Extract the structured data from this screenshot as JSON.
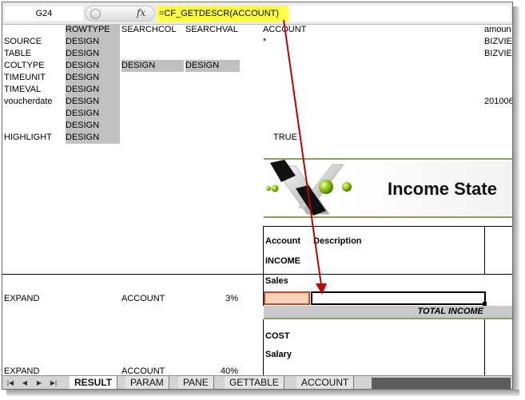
{
  "formula_bar": {
    "name_box": "G24",
    "fx_label": "fx",
    "formula": "=CF_GETDESCR(ACCOUNT)"
  },
  "grid": {
    "col_headers": {
      "rowtype": "ROWTYPE",
      "searchcol": "SEARCHCOL",
      "searchval": "SEARCHVAL",
      "account": "ACCOUNT",
      "amount": "amoun"
    },
    "rows": [
      {
        "label": "SOURCE",
        "rowtype": "DESIGN",
        "account": "*",
        "amount": "BIZVIE"
      },
      {
        "label": "TABLE",
        "rowtype": "DESIGN",
        "amount": "BIZVIE"
      },
      {
        "label": "COLTYPE",
        "rowtype": "DESIGN",
        "searchcol": "DESIGN",
        "searchval": "DESIGN"
      },
      {
        "label": "TIMEUNIT",
        "rowtype": "DESIGN"
      },
      {
        "label": "TIMEVAL",
        "rowtype": "DESIGN"
      },
      {
        "label": "voucherdate",
        "rowtype": "DESIGN",
        "amount": "201006"
      },
      {
        "label": "",
        "rowtype": "DESIGN"
      },
      {
        "label": "",
        "rowtype": "DESIGN"
      },
      {
        "label": "HIGHLIGHT",
        "rowtype": "DESIGN",
        "account": "TRUE"
      }
    ],
    "expand_rows": [
      {
        "label": "EXPAND",
        "searchcol": "ACCOUNT",
        "searchval": "3%"
      },
      {
        "label": "EXPAND",
        "searchcol": "ACCOUNT",
        "searchval": "40%"
      }
    ]
  },
  "report": {
    "title": "Income State",
    "account_header": "Account",
    "description_header": "Description",
    "income": "INCOME",
    "sales": "Sales",
    "total_income": "TOTAL INCOME",
    "cost": "COST",
    "salary": "Salary"
  },
  "tabs": {
    "items": [
      "RESULT",
      "PARAM",
      "PANE",
      "GETTABLE",
      "ACCOUNT"
    ],
    "active": "RESULT",
    "nav": [
      "first-sheet-icon",
      "prev-sheet-icon",
      "next-sheet-icon",
      "last-sheet-icon"
    ]
  },
  "colors": {
    "formula_highlight": "#ffff44",
    "design_fill": "#c0c0c0",
    "arrow": "#c00000",
    "header_rule": "#8aa05a",
    "logo_green": "#7fb800"
  }
}
